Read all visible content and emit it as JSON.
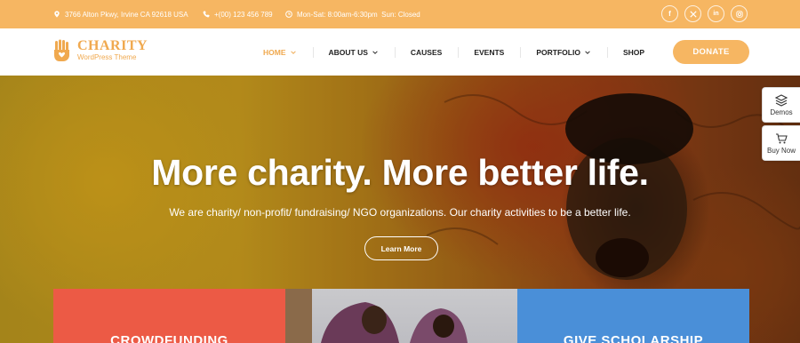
{
  "topbar": {
    "address": "3766 Alton Pkwy, Irvine CA 92618 USA",
    "phone": "+(00) 123 456 789",
    "hours": "Mon-Sat: 8:00am-6:30pm  Sun: Closed",
    "socials": [
      "facebook-icon",
      "x-icon",
      "linkedin-icon",
      "instagram-icon"
    ]
  },
  "brand": {
    "name": "CHARITY",
    "tagline": "WordPress Theme",
    "color": "#f0a94f"
  },
  "nav": {
    "items": [
      {
        "label": "HOME",
        "dropdown": true,
        "active": true
      },
      {
        "label": "ABOUT US",
        "dropdown": true
      },
      {
        "label": "CAUSES"
      },
      {
        "label": "EVENTS"
      },
      {
        "label": "PORTFOLIO",
        "dropdown": true
      },
      {
        "label": "SHOP"
      }
    ],
    "donate_label": "DONATE"
  },
  "hero": {
    "title": "More charity. More better life.",
    "subtitle": "We are charity/ non-profit/ fundraising/ NGO organizations. Our charity activities to be a better life.",
    "button_label": "Learn More"
  },
  "side_widgets": [
    {
      "label": "Demos",
      "icon": "layers-icon"
    },
    {
      "label": "Buy Now",
      "icon": "cart-icon"
    }
  ],
  "cards": [
    {
      "title": "CROWDFUNDING",
      "color": "#ec5a45"
    },
    {
      "title": "",
      "color": "#c9c9cc"
    },
    {
      "title": "GIVE SCHOLARSHIP",
      "color": "#4a8fd8"
    }
  ]
}
